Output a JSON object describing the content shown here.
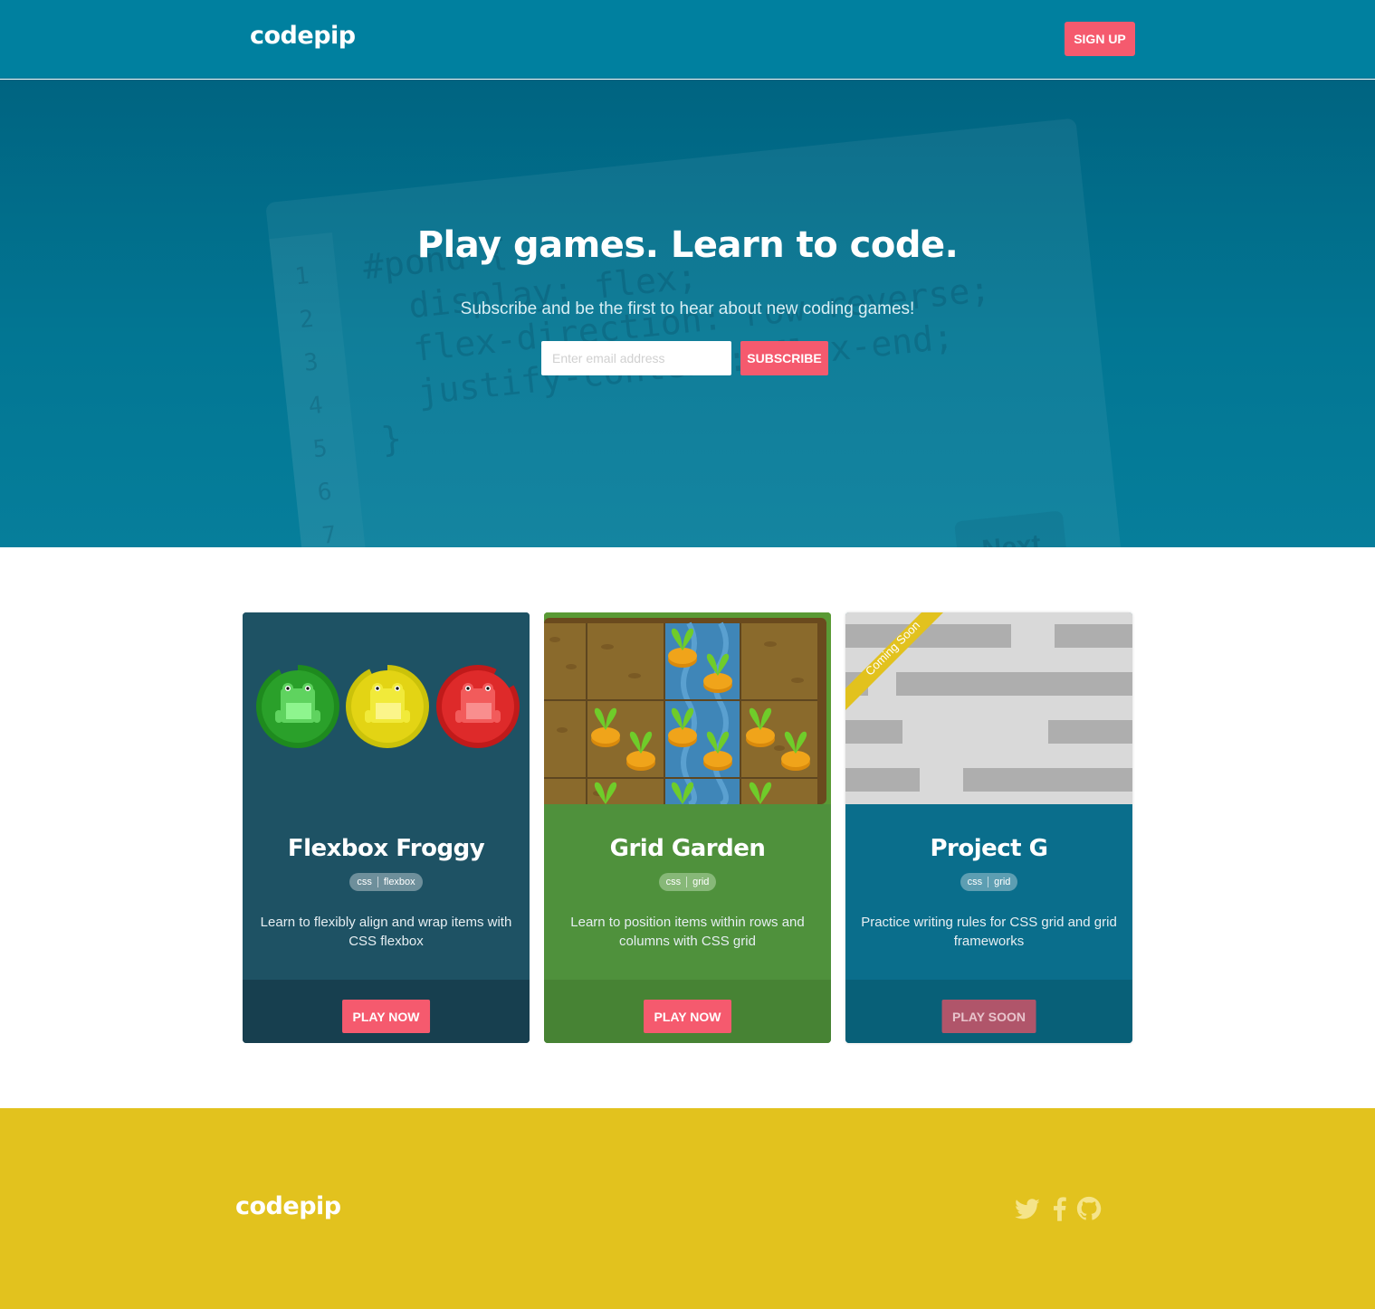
{
  "header": {
    "logo": "codepip",
    "signup_label": "SIGN UP"
  },
  "hero": {
    "title": "Play games. Learn to code.",
    "subtitle": "Subscribe and be the first to hear about new coding games!",
    "email_placeholder": "Enter email address",
    "email_value": "",
    "subscribe_label": "SUBSCRIBE",
    "background_code": {
      "line_numbers": [
        "1",
        "2",
        "3",
        "4",
        "5",
        "6",
        "7"
      ],
      "lines": [
        "#pond {",
        "  display: flex;",
        "  flex-direction: row-reverse;",
        "  justify-content: flex-end;",
        "}"
      ],
      "next_label": "Next"
    }
  },
  "cards": [
    {
      "title": "Flexbox Froggy",
      "tags": [
        "css",
        "flexbox"
      ],
      "description": "Learn to flexibly align and wrap items with CSS flexbox",
      "button_label": "PLAY NOW",
      "colors": {
        "card": "#1e5264",
        "footer": "#173f4f"
      }
    },
    {
      "title": "Grid Garden",
      "tags": [
        "css",
        "grid"
      ],
      "description": "Learn to position items within rows and columns with CSS grid",
      "button_label": "PLAY NOW",
      "colors": {
        "card": "#4f913c",
        "footer": "#478334"
      }
    },
    {
      "title": "Project G",
      "tags": [
        "css",
        "grid"
      ],
      "description": "Practice writing rules for CSS grid and grid frameworks",
      "button_label": "PLAY SOON",
      "ribbon": "Coming Soon",
      "colors": {
        "card": "#0a6e8c",
        "footer": "#086078"
      }
    }
  ],
  "footer": {
    "logo": "codepip",
    "social": [
      {
        "icon": "twitter-icon"
      },
      {
        "icon": "facebook-icon"
      },
      {
        "icon": "github-icon"
      }
    ]
  },
  "colors": {
    "header_bg": "#00809f",
    "hero_bg": "#027693",
    "accent": "#f55a6e",
    "footer_bg": "#e2c21e"
  }
}
